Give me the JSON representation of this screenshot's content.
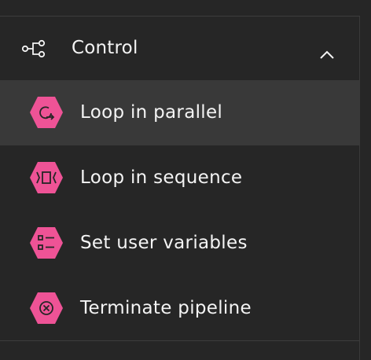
{
  "section": {
    "title": "Control",
    "icon": "flow-branch-icon",
    "expanded": true,
    "chevron_icon": "chevron-up-icon"
  },
  "items": [
    {
      "label": "Loop in parallel",
      "icon": "loop-parallel-icon",
      "selected": true
    },
    {
      "label": "Loop in sequence",
      "icon": "loop-sequence-icon",
      "selected": false
    },
    {
      "label": "Set user variables",
      "icon": "set-variables-icon",
      "selected": false
    },
    {
      "label": "Terminate pipeline",
      "icon": "terminate-icon",
      "selected": false
    }
  ],
  "colors": {
    "background": "#262626",
    "selected_background": "#393939",
    "accent_pink": "#ee5396",
    "text": "#f4f4f4",
    "divider": "#3d3d3d"
  }
}
